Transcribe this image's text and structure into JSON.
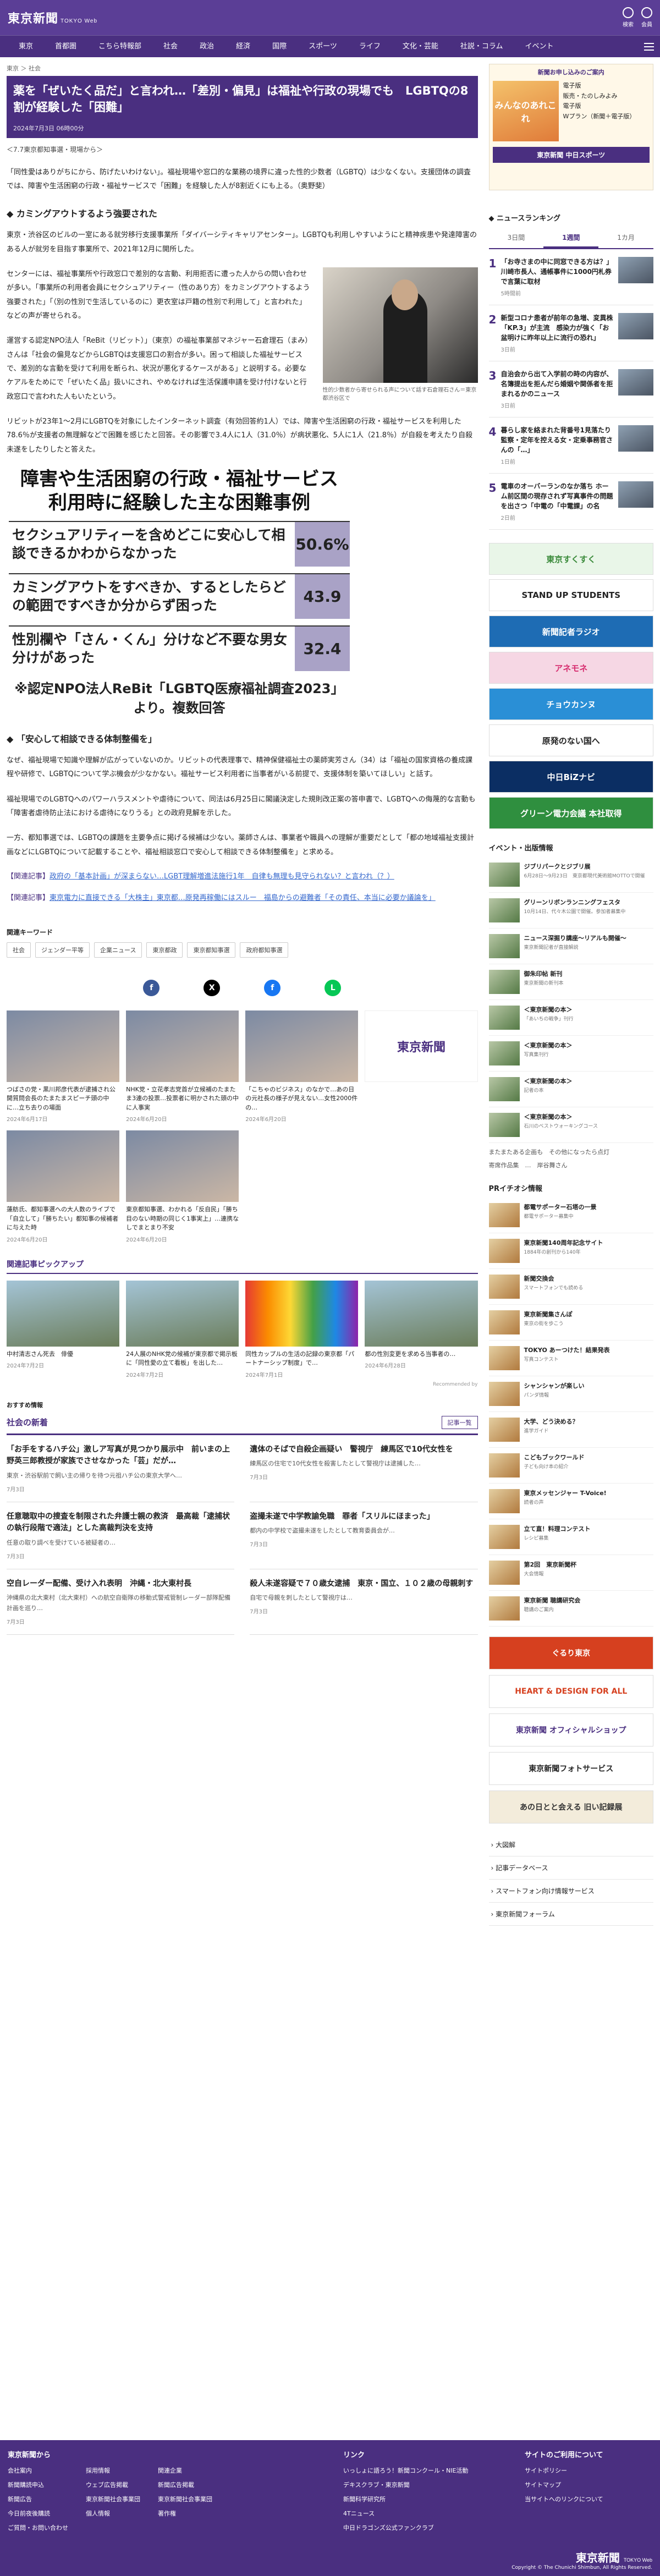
{
  "header": {
    "logo": "東京新聞",
    "logo_sub": "TOKYO Web",
    "actions": [
      "検索",
      "会員"
    ]
  },
  "nav": [
    "東京",
    "首都圏",
    "こちら特報部",
    "社会",
    "政治",
    "経済",
    "国際",
    "スポーツ",
    "ライフ",
    "文化・芸能",
    "社説・コラム",
    "イベント"
  ],
  "article": {
    "breadcrumb": "東京 ＞ 社会",
    "title": "薬を「ぜいたく品だ」と言われ…「差別・偏見」は福祉や行政の現場でも　LGBTQの8割が経験した「困難」",
    "date": "2024年7月3日 06時00分",
    "byline": "＜7.7東京都知事選・現場から＞",
    "lead": "「同性愛はありがちにから、防げたいわけない」。福祉現場や窓口的な業務の境界に違った性的少数者（LGBTQ）は少なくない。支援団体の調査では、障害や生活困窮の行政・福祉サービスで「困難」を経験した人が8割近くにも上る。（奥野斐）",
    "section1": "カミングアウトするよう強要された",
    "p1": "東京・渋谷区のビルの一室にある就労移行支援事業所「ダイバーシティキャリアセンター」。LGBTQも利用しやすいようにと精神疾患や発達障害のある人が就労を目指す事業所で、2021年12月に開所した。",
    "p2": "センターには、福祉事業所や行政窓口で差別的な言動、利用拒否に遭った人からの問い合わせが多い。「事業所の利用者会員にセクシュアリティー（性のあり方）をカミングアウトするよう強要された」「（別の性別で生活しているのに）更衣室は戸籍の性別で利用して」と言われた」などの声が寄せられる。",
    "p3": "運営する認定NPO法人「ReBit（リビット）」（東京）の福祉事業部マネジャー石倉理石（まみ）さんは「社会の偏見などからLGBTQは支援窓口の割合が多い。困って相談した福祉サービスで、差別的な言動を受けて利用を断られ、状況が悪化するケースがある」と説明する。必要なケアルをためにで「ぜいたく品」扱いにされ、やめなければ生活保護申請を受け付けないと行政窓口で言われた人もいたという。",
    "caption": "性的少数者から寄せられる声について話す石倉理石さん＝東京都渋谷区で",
    "p4": "リビットが23年1〜2月にLGBTQを対象にしたインターネット調査（有効回答約1人）では、障害や生活困窮の行政・福祉サービスを利用した78.6％が支援者の無理解などで困難を感じたと回答。その影響で3.4人に1人（31.0％）が病状悪化、5人に1人（21.8％）が自殺を考えたり自殺未遂をしたりしたと答えた。",
    "section2": "「安心して相談できる体制整備を」",
    "p5": "なぜ、福祉現場で知識や理解が広がっていないのか。リビットの代表理事で、精神保健福祉士の薬師実芳さん（34）は「福祉の国家資格の養成課程や研修で、LGBTQについて学ぶ機会が少なかない。福祉サービス利用者に当事者がいる前提で、支援体制を築いてほしい」と話す。",
    "p6": "福祉現場でのLGBTQへのパワーハラスメントや虐待について、同法は6月25日に閣議決定した規則改正案の答申書で、LGBTQへの侮蔑的な言動も「障害者虐待防止法における虐待になりうる」との政府見解を示した。",
    "p7": "一方、都知事選では、LGBTQの課題を主要争点に掲げる候補は少ない。薬師さんは、事業者や職員への理解が重要だとして「都の地域福祉支援計画などにLGBTQについて記載することや、福祉相談窓口で安心して相談できる体制整備を」と求める。",
    "related": [
      {
        "label": "【関連記事】",
        "text": "政府の「基本計画」が深まらない…LGBT理解増進法施行1年　自律も無理も見守られない？と言われ（？）"
      },
      {
        "label": "【関連記事】",
        "text": "東京電力に直接できる「大株主」東京都…原発再稼働にはスルー　福島からの避難者「その責任、本当に必要か議論を」"
      }
    ]
  },
  "infographic": {
    "title_line1": "障害や生活困窮の行政・福祉サービス",
    "title_line2": "利用時に経験した主な困難事例",
    "rows": [
      {
        "text": "セクシュアリティーを含めどこに安心して相談できるかわからなかった",
        "value": "50.6%"
      },
      {
        "text": "カミングアウトをすべきか、するとしたらどの範囲ですべきか分からず困った",
        "value": "43.9"
      },
      {
        "text": "性別欄や「さん・くん」分けなど不要な男女分けがあった",
        "value": "32.4"
      }
    ],
    "source": "※認定NPO法人ReBit「LGBTQ医療福祉調査2023」より。複数回答"
  },
  "keywords": {
    "heading": "関連キーワード",
    "items": [
      "社会",
      "ジェンダー平等",
      "企業ニュース",
      "東京都政",
      "東京都知事選",
      "政府都知事選"
    ]
  },
  "share": [
    "f",
    "X",
    "f",
    "L"
  ],
  "cards": [
    {
      "title": "つばさの党・黒川邦彦代表が逮捕され公開質問会長のたまたまスピーチ頭の中に…立ち去りの場面",
      "date": "2024年6月17日"
    },
    {
      "title": "NHK党・立花孝志党首が立候補のたまたま3連の投票…投票者に明かされた頭の中に人事実",
      "date": "2024年6月20日"
    },
    {
      "title": "「こちゃのビジネス」のなかで…あの日の元社長の様子が見えない…女性2000件の…",
      "date": "2024年6月20日"
    },
    {
      "title": "",
      "date": ""
    },
    {
      "title": "蓮舫氏、都知事選への大人数のライブで「自立して」「勝ちたい」都知事の候補者に与えた時",
      "date": "2024年6月20日"
    },
    {
      "title": "東京都知事選、わかれる「反自民」「勝ち目のない時期の同じく1事実上」…連携なしでまとまり不安",
      "date": "2024年6月20日"
    }
  ],
  "pickup": {
    "heading": "関連記事ピックアップ",
    "items": [
      {
        "title": "中村清志さん死去　俳優",
        "date": "2024年7月2日"
      },
      {
        "title": "24人展のNHK党の候補が東京都で掲示板に「同性愛の立て看板」を出した…",
        "date": "2024年7月2日"
      },
      {
        "title": "同性カップルの生活の記録の東京都「パートナーシップ制度」で…",
        "date": "2024年7月1日"
      },
      {
        "title": "都の性別変更を求める当事者の…",
        "date": "2024年6月28日"
      }
    ],
    "recommend": "Recommended by"
  },
  "osusume": "おすすめ情報",
  "social_news": {
    "heading": "社会の新着",
    "more": "記事一覧",
    "items": [
      {
        "h": "「お手をするハチ公」激しア写真が見つかり展示中　前いまの上野英三郎教授が家族でさせなかった「芸」だが…",
        "b": "東京・渋谷駅前で飼い主の帰りを待つ元祖ハチ公の東京大学へ…",
        "d": "7月3日"
      },
      {
        "h": "遺体のそばで自殺企画疑い　警視庁　練馬区で10代女性を",
        "b": "練馬区の住宅で10代女性を殺害したとして警視庁は逮捕した…",
        "d": "7月3日"
      },
      {
        "h": "任意聴取中の捜査を制限された弁護士親の救済　最高裁「逮捕状の執行段階で適法」とした高裁判決を支持",
        "b": "任意の取り調べを受けている被疑者の…",
        "d": "7月3日"
      },
      {
        "h": "盗撮未遂で中学教諭免職　罪者「スリルにほまった」",
        "b": "都内の中学校で盗撮未遂をしたとして教育委員会が…",
        "d": "7月3日"
      },
      {
        "h": "空自レーダー配備、受け入れ表明　沖縄・北大東村長",
        "b": "沖縄県の北大東村（北大東村）への航空自衛隊の移動式警戒管制レーダー部隊配備計画を巡り…",
        "d": "7月3日"
      },
      {
        "h": "殺人未遂容疑で７０歳女逮捕　東京・国立、１０２歳の母親刺す",
        "b": "自宅で母親を刺したとして警視庁は…",
        "d": "7月3日"
      }
    ]
  },
  "sidebar": {
    "banner_head": "新聞お申し込みのご案内",
    "banner_img": "みんなのあれこれ",
    "banner_rows": [
      "電子版",
      "販売・たのしみよみ",
      "電子版",
      "Wプラン（新聞＋電子版）"
    ],
    "banner_foot": "東京新聞 中日スポーツ",
    "ranking": {
      "heading": "ニュースランキング",
      "tabs": [
        "3日間",
        "1週間",
        "1カ月"
      ],
      "active_tab": 1,
      "items": [
        {
          "n": "1",
          "t": "「お寺さまの中に同窓できる方は？」川崎市長人、通帳事件に1000円札券で言葉に取材",
          "d": "5時間前"
        },
        {
          "n": "2",
          "t": "新型コロナ患者が前年の急増、変異株「KP.3」が主流　感染力が強く「お盆明けに昨年以上に流行の恐れ」",
          "d": "3日前"
        },
        {
          "n": "3",
          "t": "自治会から出て入学前の時の内容が、名簿提出を拒んだら婚姻や関係者を拒まれるかのニュース",
          "d": "3日前"
        },
        {
          "n": "4",
          "t": "暮らし家を絡まれた背番号1見落たり監察・定年を控える女・定乗事務官さんの「…」",
          "d": "1日前"
        },
        {
          "n": "5",
          "t": "電車のオーバーランのなか落ち ホーム前区間の現存されず写真事件の問題を出さつ「中電の「中電課」の名",
          "d": "2日前"
        }
      ]
    },
    "ads": [
      {
        "text": "東京すくすく",
        "bg": "#e9f6e8",
        "fg": "#3a8a3a"
      },
      {
        "text": "STAND UP STUDENTS",
        "bg": "#ffffff",
        "fg": "#222222"
      },
      {
        "text": "新聞記者ラジオ",
        "bg": "#1e6cb4",
        "fg": "#ffffff"
      },
      {
        "text": "アネモネ",
        "bg": "#f6d7e4",
        "fg": "#d62a6d"
      },
      {
        "text": "チョウカンヌ",
        "bg": "#2a8fd6",
        "fg": "#ffffff"
      },
      {
        "text": "原発のない国へ",
        "bg": "#ffffff",
        "fg": "#222222"
      },
      {
        "text": "中日BiZナビ",
        "bg": "#0b2e63",
        "fg": "#ffffff"
      },
      {
        "text": "グリーン電力会議 本社取得",
        "bg": "#2f8f3f",
        "fg": "#ffffff"
      }
    ],
    "events": {
      "heading": "イベント・出版情報",
      "items": [
        {
          "t": "ジブリパークとジブリ展",
          "s": "6月28日〜9月23日　東京都現代美術館MOTTOで開催"
        },
        {
          "t": "グリーンリボンランニングフェスタ",
          "s": "10月14日、代々木公園で開催。参加者募集中"
        },
        {
          "t": "ニュース深掘り講座〜リアルも開催〜",
          "s": "東京新聞記者が直接解説"
        },
        {
          "t": "御朱印帖 新刊",
          "s": "東京新聞の新刊本"
        },
        {
          "t": "＜東京新聞の本＞",
          "s": "「あいちの戦争」刊行"
        },
        {
          "t": "＜東京新聞の本＞",
          "s": "写真集刊行"
        },
        {
          "t": "＜東京新聞の本＞",
          "s": "記者の本"
        },
        {
          "t": "＜東京新聞の本＞",
          "s": "石川のベストウォーキングコース"
        }
      ],
      "more": "またまたある企画も　その他になったら点灯",
      "more2": "寄席作品集　…　岸谷舞さん"
    },
    "pr": {
      "heading": "PRイチオシ情報",
      "items": [
        {
          "t": "都電サポーター石塔の一景",
          "s": "都電サポーター募集中"
        },
        {
          "t": "東京新聞140周年記念サイト",
          "s": "1884年の創刊から140年"
        },
        {
          "t": "新聞交換会",
          "s": "スマートフォンでも読める"
        },
        {
          "t": "東京新聞集さんぽ",
          "s": "東京の街を歩こう"
        },
        {
          "t": "TOKYO あーつけた！結果発表",
          "s": "写真コンテスト"
        },
        {
          "t": "シャンシャンが楽しい",
          "s": "パンダ情報"
        },
        {
          "t": "大学、どう決める？",
          "s": "進学ガイド"
        },
        {
          "t": "こどもブックワールド",
          "s": "子ども向け本の紹介"
        },
        {
          "t": "東京メッセンジャー T-Voice!",
          "s": "読者の声"
        },
        {
          "t": "立て直！料理コンテスト",
          "s": "レシピ募集"
        },
        {
          "t": "第2回　東京新聞杯",
          "s": "大会情報"
        },
        {
          "t": "東京新聞 聴講研究会",
          "s": "聴講のご案内"
        }
      ]
    },
    "ads2": [
      {
        "text": "ぐるり東京",
        "bg": "#d6401f",
        "fg": "#ffffff"
      },
      {
        "text": "HEART & DESIGN FOR ALL",
        "bg": "#ffffff",
        "fg": "#d6401f"
      },
      {
        "text": "東京新聞 オフィシャルショップ",
        "bg": "#ffffff",
        "fg": "#4a2f80"
      },
      {
        "text": "東京新聞フォトサービス",
        "bg": "#ffffff",
        "fg": "#222222"
      },
      {
        "text": "あの日とと会える 旧い記録展",
        "bg": "#f3ecdb",
        "fg": "#333333"
      }
    ],
    "links": [
      "大図解",
      "記事データベース",
      "スマートフォン向け情報サービス",
      "東京新聞フォーラム"
    ]
  },
  "footer": {
    "col1_head": "東京新聞から",
    "col1a": [
      "会社案内",
      "新聞購読申込",
      "新聞広告",
      "今日前夜後購読",
      "ご質問・お問い合わせ"
    ],
    "col1b": [
      "採用情報",
      "ウェブ広告掲載",
      "東京新聞社会事業団",
      "個人情報"
    ],
    "col1c": [
      "関連企業",
      "新聞広告掲載",
      "東京新聞社会事業団",
      "著作権"
    ],
    "col2_head": "リンク",
    "col2": [
      "いっしょに語ろう！新聞コンクール・NIE活動",
      "デキスクラブ・東京新聞",
      "新聞科学研究所",
      "4Tニュース",
      "中日ドラゴンズ公式ファンクラブ"
    ],
    "col3_head": "サイトのご利用について",
    "col3": [
      "サイトポリシー",
      "サイトマップ",
      "当サイトへのリンクについて"
    ],
    "logo": "東京新聞",
    "logo_sub": "TOKYO Web",
    "copy": "Copyright © The Chunichi Shimbun, All Rights Reserved."
  }
}
